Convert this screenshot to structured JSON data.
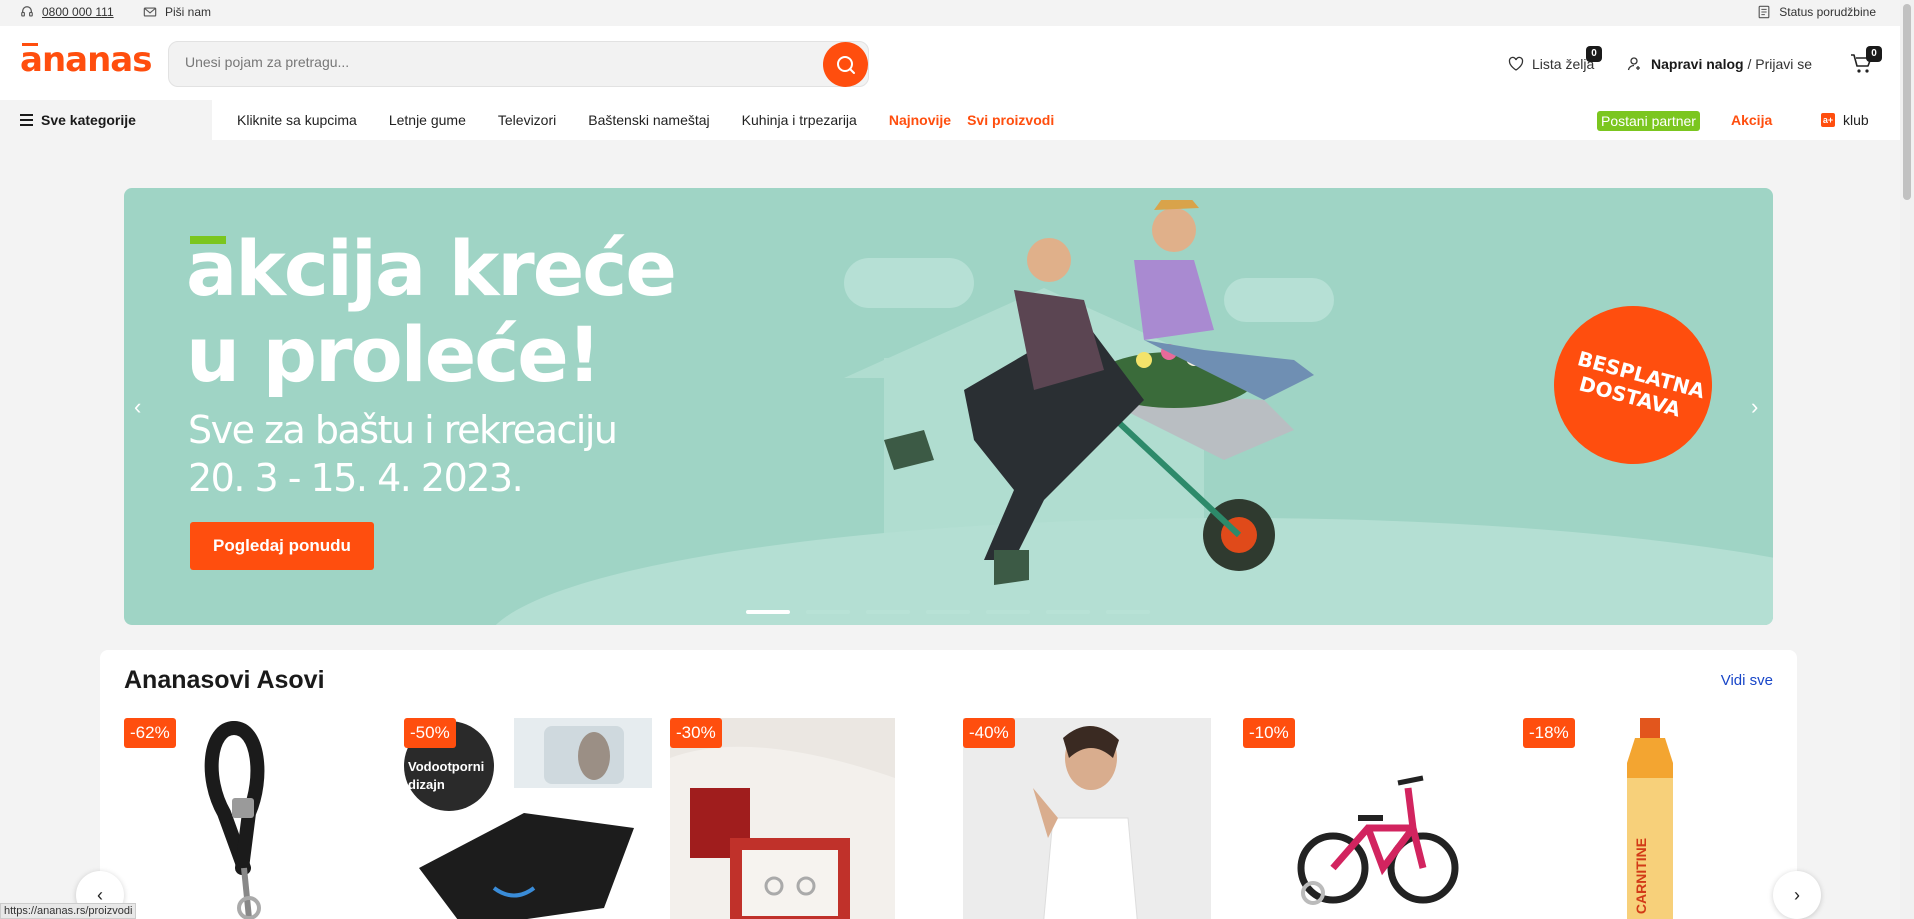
{
  "utility": {
    "phone": "0800 000 111",
    "mail": "Piši nam",
    "order_status": "Status porudžbine"
  },
  "header": {
    "logo": "ananas",
    "search_placeholder": "Unesi pojam za pretragu...",
    "wishlist_label": "Lista želja",
    "wishlist_count": "0",
    "account_strong": "Napravi nalog",
    "account_sep": " / ",
    "account_login": "Prijavi se",
    "cart_count": "0"
  },
  "nav": {
    "all_categories": "Sve kategorije",
    "links": [
      "Kliknite sa kupcima",
      "Letnje gume",
      "Televizori",
      "Baštenski nameštaj",
      "Kuhinja i trpezarija"
    ],
    "highlight_1": "Najnovije",
    "highlight_2": "Svi proizvodi",
    "partner": "Postani partner",
    "akcija": "Akcija",
    "klub": "klub",
    "klub_icon": "a+"
  },
  "hero": {
    "title_line1": "akcija kreće",
    "title_line2": "u proleće!",
    "subtitle": "Sve za baštu i rekreaciju",
    "dates": "20. 3 - 15. 4. 2023.",
    "cta": "Pogledaj ponudu",
    "sticker": "BESPLATNA DOSTAVA",
    "slide_count": 7,
    "active_slide": 1
  },
  "products": {
    "title": "Ananasovi Asovi",
    "see_all": "Vidi sve",
    "items": [
      {
        "discount": "-62%",
        "icon": "leash-icon",
        "inset_text": ""
      },
      {
        "discount": "-50%",
        "icon": "litter-mat-icon",
        "inset_text": "Vodootporni dizajn"
      },
      {
        "discount": "-30%",
        "icon": "earrings-box-icon",
        "inset_text": ""
      },
      {
        "discount": "-40%",
        "icon": "top-model-icon",
        "inset_text": ""
      },
      {
        "discount": "-10%",
        "icon": "kids-bike-icon",
        "inset_text": ""
      },
      {
        "discount": "-18%",
        "icon": "drink-bottle-icon",
        "inset_text": "CARNITINE"
      }
    ]
  },
  "status_url": "https://ananas.rs/proizvodi",
  "colors": {
    "brand": "#ff4e0e",
    "green": "#7bc61f",
    "hero_bg": "#9fd4c5",
    "link": "#1846c8"
  }
}
